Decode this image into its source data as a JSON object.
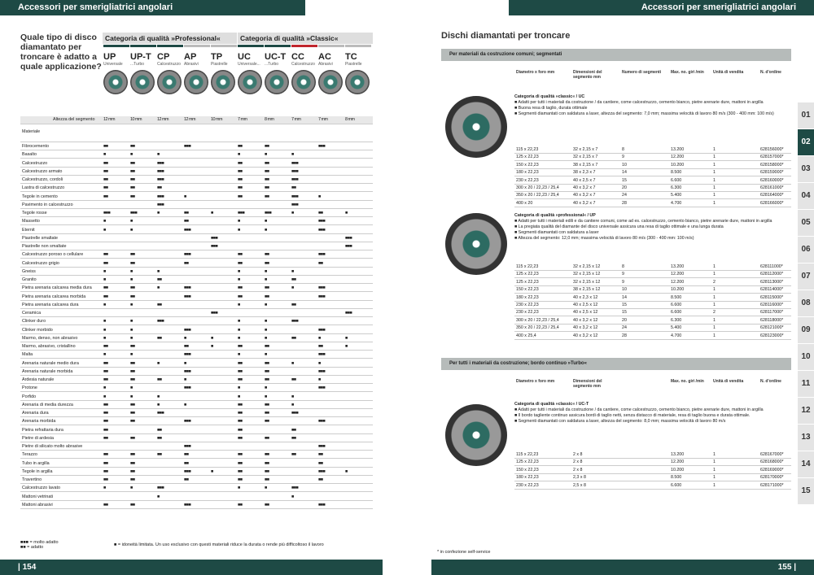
{
  "header": {
    "left": "Accessori per smerigliatrici angolari",
    "right": "Accessori per smerigliatrici angolari"
  },
  "question": "Quale tipo di disco diamantato per troncare è adatto a quale applicazione?",
  "categories": [
    "Categoria di qualità »Professional«",
    "Categoria di qualità »Classic«"
  ],
  "codes": [
    {
      "c": "UP",
      "n": "Universale"
    },
    {
      "c": "UP-T",
      "n": "...Turbo"
    },
    {
      "c": "CP",
      "n": "Calcestruzzo"
    },
    {
      "c": "AP",
      "n": "Abrasivi"
    },
    {
      "c": "TP",
      "n": "Piastrelle"
    },
    {
      "c": "UC",
      "n": "Universale..."
    },
    {
      "c": "UC-T",
      "n": "...Turbo"
    },
    {
      "c": "CC",
      "n": "Calcestruzzo"
    },
    {
      "c": "AC",
      "n": "Abrasivi"
    },
    {
      "c": "TC",
      "n": "Piastrelle"
    }
  ],
  "height_label": "Altezza del segmento",
  "heights": [
    "12 mm",
    "10 mm",
    "12 mm",
    "12 mm",
    "10 mm",
    "7 mm",
    "8 mm",
    "7 mm",
    "7 mm",
    "8 mm"
  ],
  "materials_title": "Materiale",
  "materials": [
    [
      "Fibrocemento",
      "■■",
      "■■",
      "",
      "■■■",
      "",
      "■■",
      "■■",
      "",
      "■■■",
      ""
    ],
    [
      "Basalto",
      "■",
      "■",
      "■",
      "",
      "",
      "■",
      "■",
      "■",
      "",
      ""
    ],
    [
      "Calcestruzzo",
      "■■",
      "■■",
      "■■■",
      "",
      "",
      "■■",
      "■■",
      "■■■",
      "",
      ""
    ],
    [
      "Calcestruzzo armato",
      "■■",
      "■■",
      "■■■",
      "",
      "",
      "■■",
      "■■",
      "■■■",
      "",
      ""
    ],
    [
      "Calcestruzzo, cordoli",
      "■■",
      "■■",
      "■■■",
      "",
      "",
      "■■",
      "■■",
      "■■■",
      "",
      ""
    ],
    [
      "Lastra di calcestruzzo",
      "■■",
      "■■",
      "■■",
      "",
      "",
      "■■",
      "■■",
      "■■",
      "",
      ""
    ],
    [
      "Tegole in cemento",
      "■■",
      "■■",
      "■■■",
      "■",
      "",
      "■■",
      "■■",
      "■■■",
      "■",
      ""
    ],
    [
      "Pavimento in calcestruzzo",
      "",
      "",
      "■■■",
      "",
      "",
      "",
      "",
      "■■■",
      "",
      ""
    ],
    [
      "Tegole rosse",
      "■■■",
      "■■■",
      "■",
      "■■",
      "■",
      "■■■",
      "■■■",
      "■",
      "■■",
      "■"
    ],
    [
      "Massetto",
      "■",
      "■",
      "",
      "■■",
      "",
      "■",
      "■",
      "",
      "■■■",
      ""
    ],
    [
      "Eternit",
      "■",
      "■",
      "",
      "■■■",
      "",
      "■",
      "■",
      "",
      "■■■",
      ""
    ],
    [
      "Piastrelle smaltate",
      "",
      "",
      "",
      "",
      "■■■",
      "",
      "",
      "",
      "",
      "■■■"
    ],
    [
      "Piastrelle non smaltate",
      "",
      "",
      "",
      "",
      "■■■",
      "",
      "",
      "",
      "",
      "■■■"
    ],
    [
      "Calcestruzzo poroso o cellulare",
      "■■",
      "■■",
      "",
      "■■■",
      "",
      "■■",
      "■■",
      "",
      "■■■",
      ""
    ],
    [
      "Calcestruzzo grigio",
      "■■",
      "■■",
      "",
      "■■",
      "",
      "■■",
      "■■",
      "",
      "■■",
      ""
    ],
    [
      "Gneiss",
      "■",
      "■",
      "■",
      "",
      "",
      "■",
      "■",
      "■",
      "",
      ""
    ],
    [
      "Granito",
      "■",
      "■",
      "■■",
      "",
      "",
      "■",
      "■",
      "■■",
      "",
      ""
    ],
    [
      "Pietra arenaria calcarea media dura",
      "■■",
      "■■",
      "■",
      "■■■",
      "",
      "■■",
      "■■",
      "■",
      "■■■",
      ""
    ],
    [
      "Pietra arenaria calcarea morbida",
      "■■",
      "■■",
      "",
      "■■■",
      "",
      "■■",
      "■■",
      "",
      "■■■",
      ""
    ],
    [
      "Pietra arenaria calcarea dura",
      "■",
      "■",
      "■■",
      "",
      "",
      "■",
      "■",
      "■■",
      "",
      ""
    ],
    [
      "Ceramica",
      "",
      "",
      "",
      "",
      "■■■",
      "",
      "",
      "",
      "",
      "■■■"
    ],
    [
      "Clinker duro",
      "■",
      "■",
      "■■■",
      "",
      "",
      "■",
      "■",
      "■■■",
      "",
      ""
    ],
    [
      "Clinker morbido",
      "■",
      "■",
      "",
      "■■■",
      "",
      "■",
      "■",
      "",
      "■■■",
      ""
    ],
    [
      "Marmo, denso, non abrasivo",
      "■",
      "■",
      "■■",
      "■",
      "■",
      "■",
      "■",
      "■■",
      "■",
      "■"
    ],
    [
      "Marmo, abrasivo, cristallino",
      "■■",
      "■■",
      "",
      "■■",
      "■",
      "■■",
      "■■",
      "",
      "■■",
      "■"
    ],
    [
      "Malta",
      "■",
      "■",
      "",
      "■■■",
      "",
      "■",
      "■",
      "",
      "■■■",
      ""
    ],
    [
      "Arenaria naturale medio dura",
      "■■",
      "■■",
      "■",
      "■",
      "",
      "■■",
      "■■",
      "■",
      "■",
      ""
    ],
    [
      "Arenaria naturale morbida",
      "■■",
      "■■",
      "",
      "■■■",
      "",
      "■■",
      "■■",
      "",
      "■■■",
      ""
    ],
    [
      "Ardesia naturale",
      "■■",
      "■■",
      "■■",
      "■",
      "",
      "■■",
      "■■",
      "■■",
      "■",
      ""
    ],
    [
      "Protone",
      "■",
      "■",
      "",
      "■■■",
      "",
      "■",
      "■",
      "",
      "■■■",
      ""
    ],
    [
      "Porfido",
      "■",
      "■",
      "■",
      "",
      "",
      "■",
      "■",
      "■",
      "",
      ""
    ],
    [
      "Arenaria di media durezza",
      "■■",
      "■■",
      "■",
      "■",
      "",
      "■■",
      "■■",
      "■",
      "",
      ""
    ],
    [
      "Arenaria dura",
      "■■",
      "■■",
      "■■■",
      "",
      "",
      "■■",
      "■■",
      "■■■",
      "",
      ""
    ],
    [
      "Arenaria morbida",
      "■■",
      "■■",
      "",
      "■■■",
      "",
      "■■",
      "■■",
      "",
      "■■■",
      ""
    ],
    [
      "Pietra refrattaria dura",
      "■■",
      "",
      "■■",
      "",
      "",
      "■■",
      "",
      "■■",
      "",
      ""
    ],
    [
      "Pietre di ardesia",
      "■■",
      "■■",
      "■■",
      "",
      "",
      "■■",
      "■■",
      "■■",
      "",
      ""
    ],
    [
      "Pietre di silicato molto abrasive",
      "",
      "",
      "",
      "■■■",
      "",
      "",
      "",
      "",
      "■■■",
      ""
    ],
    [
      "Terazzo",
      "■■",
      "■■",
      "■■",
      "■■",
      "",
      "■■",
      "■■",
      "■■",
      "■■",
      ""
    ],
    [
      "Tubo in argilla",
      "■■",
      "■■",
      "",
      "■■",
      "",
      "■■",
      "■■",
      "",
      "■■",
      ""
    ],
    [
      "Tegole in argilla",
      "■■",
      "■■",
      "",
      "■■■",
      "■",
      "■■",
      "■■",
      "",
      "■■■",
      "■"
    ],
    [
      "Travertino",
      "■■",
      "■■",
      "",
      "■■",
      "",
      "■■",
      "■■",
      "",
      "■■",
      ""
    ],
    [
      "Calcestruzzo lavato",
      "■",
      "■",
      "■■■",
      "",
      "",
      "■",
      "■",
      "■■■",
      "",
      ""
    ],
    [
      "Mattoni vetrinati",
      "",
      "",
      "■",
      "",
      "",
      "",
      "",
      "■",
      "",
      ""
    ],
    [
      "Mattoni abrasivi",
      "■■",
      "■■",
      "",
      "■■■",
      "",
      "■■",
      "■■",
      "",
      "■■■",
      ""
    ]
  ],
  "legend": {
    "a": "■■■ = molto adatto",
    "b": "■■ = adatto",
    "c": "■ = idoneità limitata. Un uso esclusivo con questi materiali riduce la durata o rende più difficoltoso il lavoro"
  },
  "right": {
    "title": "Dischi diamantati per troncare",
    "sec1": "Per materiali da costruzione comuni; segmentati",
    "sec2": "Per tutti i materiali da costruzione; bordo continuo »Turbo«",
    "cols": [
      "Diametro x foro mm",
      "Dimensioni del segmento mm",
      "Numero di segmenti",
      "Max. no. giri /min",
      "Unità di vendita",
      "N. d'ordine"
    ],
    "cols2": [
      "Diametro x foro mm",
      "Dimensioni del segmento mm",
      "Max. no. giri /min",
      "Unità di vendita",
      "N. d'ordine"
    ],
    "uc_title": "Categoria di qualità »classic« / UC",
    "uc_lines": [
      "■ Adatti per tutti i materiali da costruzione / da cantiere, come calcestruzzo, cemento bianco, pietre arenarie dure, mattoni in argilla",
      "■ Buona resa di taglio, durata ottimale",
      "■ Segmenti diamantati con saldatura a laser, altezza del segmento: 7,0 mm; massima velocità di lavoro 80 m/s (300 - 400 mm: 100 m/s)"
    ],
    "uc_rows": [
      [
        "115 x 22,23",
        "32 x 2,15 x 7",
        "8",
        "13.200",
        "1",
        "628156000*"
      ],
      [
        "125 x 22,23",
        "32 x 2,15 x 7",
        "9",
        "12.200",
        "1",
        "628157000*"
      ],
      [
        "150 x 22,23",
        "38 x 2,15 x 7",
        "10",
        "10.200",
        "1",
        "628158000*"
      ],
      [
        "180 x 22,23",
        "38 x 2,3 x 7",
        "14",
        "8.500",
        "1",
        "628159000*"
      ],
      [
        "230 x 22,23",
        "40 x 2,5 x 7",
        "15",
        "6.600",
        "1",
        "628160000*"
      ],
      [
        "300 x 20 / 22,23 / 25,4",
        "40 x 3,2 x 7",
        "20",
        "6.300",
        "1",
        "628161000*"
      ],
      [
        "350 x 20 / 22,23 / 25,4",
        "40 x 3,2 x 7",
        "24",
        "5.400",
        "1",
        "628164000*"
      ],
      [
        "400 x 20",
        "40 x 3,2 x 7",
        "28",
        "4.700",
        "1",
        "628166000*"
      ]
    ],
    "up_title": "Categoria di qualità »professional« / UP",
    "up_lines": [
      "■ Adatti per tutti i materiali edili e da cantiere comuni, come ad es. calcestruzzo, cemento bianco, pietre arenarie dure, mattoni in argilla",
      "■ La pregiata qualità del diamante del disco universale assicura una resa di taglio ottimale e una lunga durata",
      "■ Segmenti diamantati con saldatura a laser",
      "■ Altezza del segmento: 12,0 mm; massima velocità di lavoro 80 m/s (300 - 400 mm: 100 m/s)"
    ],
    "up_rows": [
      [
        "115 x 22,23",
        "32 x 2,15 x 12",
        "8",
        "13.200",
        "1",
        "628111000*"
      ],
      [
        "125 x 22,23",
        "32 x 2,15 x 12",
        "9",
        "12.200",
        "1",
        "628112000*"
      ],
      [
        "125 x 22,23",
        "32 x 2,15 x 12",
        "9",
        "12.200",
        "2",
        "628113000*"
      ],
      [
        "150 x 22,23",
        "38 x 2,15 x 12",
        "10",
        "10.200",
        "1",
        "628114000*"
      ],
      [
        "180 x 22,23",
        "40 x 2,3 x 12",
        "14",
        "8.500",
        "1",
        "628115000*"
      ],
      [
        "230 x 22,23",
        "40 x 2,5 x 12",
        "15",
        "6.600",
        "1",
        "628116000*"
      ],
      [
        "230 x 22,23",
        "40 x 2,5 x 12",
        "15",
        "6.600",
        "2",
        "628117000*"
      ],
      [
        "300 x 20 / 22,23 / 25,4",
        "40 x 3,2 x 12",
        "20",
        "6.300",
        "1",
        "628118000*"
      ],
      [
        "350 x 20 / 22,23 / 25,4",
        "40 x 3,2 x 12",
        "24",
        "5.400",
        "1",
        "628121000*"
      ],
      [
        "400 x 25,4",
        "40 x 3,2 x 12",
        "28",
        "4.700",
        "1",
        "628123000*"
      ]
    ],
    "uct_title": "Categoria di qualità »classic« / UC-T",
    "uct_lines": [
      "■ Adatti per tutti i materiali da costruzione / da cantiere, come calcestruzzo, cemento bianco, pietre arenarie dure, mattoni in argilla",
      "■ Il bordo tagliente continuo assicura bordi di taglio netti, senza distacco di materiale, resa di taglio buona e durata ottimale.",
      "■ Segmenti diamantati con saldatura a laser, altezza del segmento: 8,0 mm; massima velocità di lavoro 80 m/s"
    ],
    "uct_rows": [
      [
        "115 x 22,23",
        "2 x 8",
        "13.200",
        "1",
        "628167000*"
      ],
      [
        "125 x 22,23",
        "2 x 8",
        "12.200",
        "1",
        "628168000*"
      ],
      [
        "150 x 22,23",
        "2 x 8",
        "10.200",
        "1",
        "628169000*"
      ],
      [
        "180 x 22,23",
        "2,3 x 8",
        "8.500",
        "1",
        "628170000*"
      ],
      [
        "230 x 22,23",
        "2,5 x 8",
        "6.600",
        "1",
        "628171000*"
      ]
    ],
    "note": "* in confezione self-service"
  },
  "tabs": [
    "01",
    "02",
    "03",
    "04",
    "05",
    "06",
    "07",
    "08",
    "09",
    "10",
    "11",
    "12",
    "13",
    "14",
    "15"
  ],
  "active_tab": "02",
  "page_left": "| 154",
  "page_right": "155 |"
}
